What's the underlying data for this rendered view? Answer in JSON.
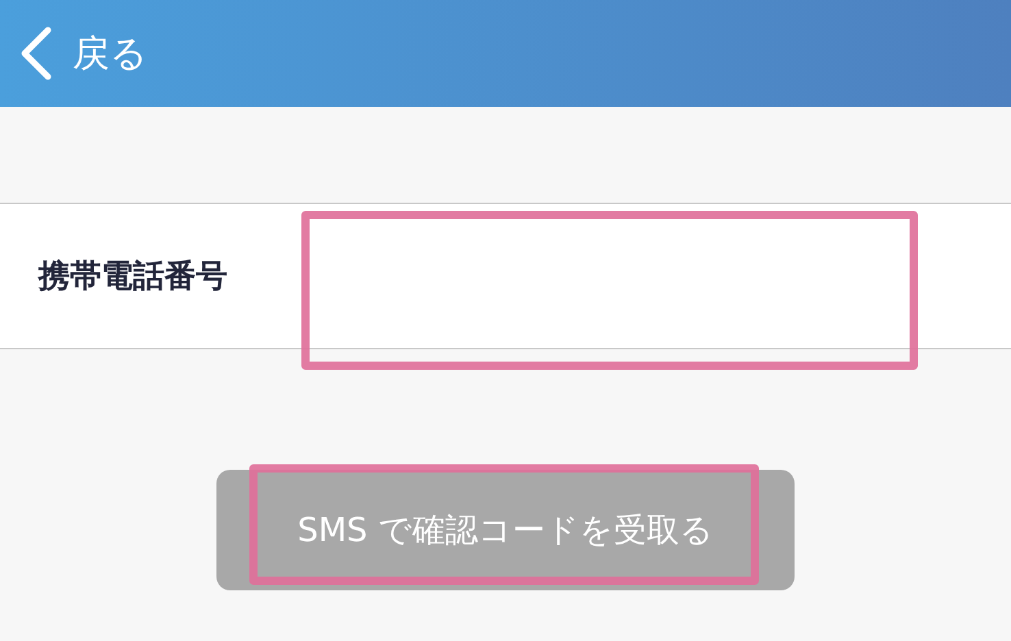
{
  "header": {
    "back_label": "戻る"
  },
  "form": {
    "phone_label": "携帯電話番号"
  },
  "submit": {
    "label": "SMS で確認コードを受取る",
    "disabled": true
  }
}
